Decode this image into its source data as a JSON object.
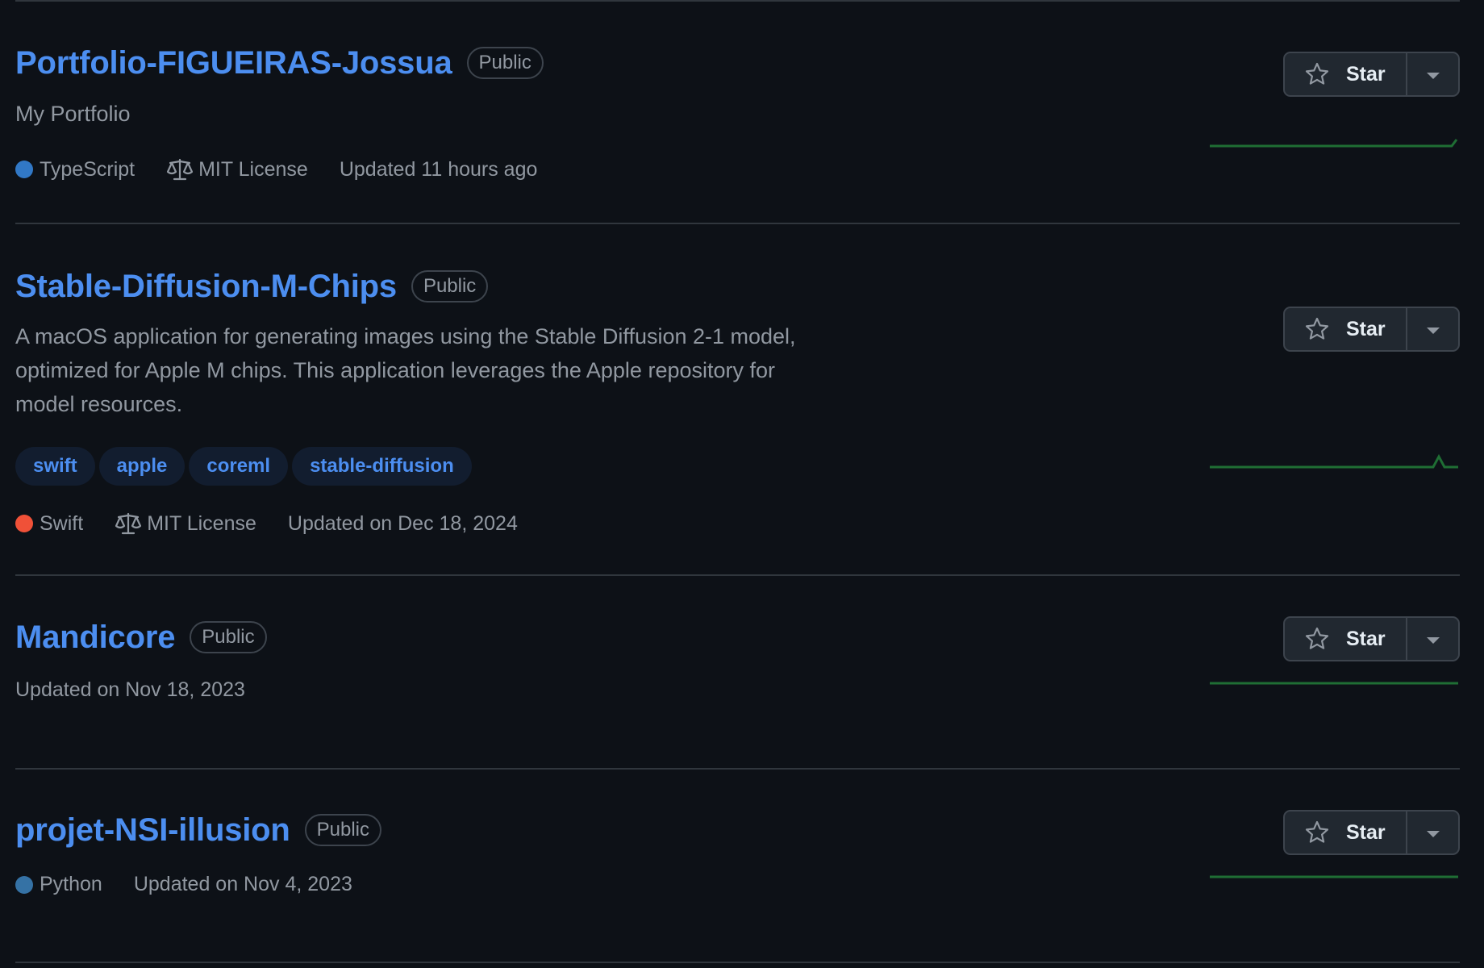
{
  "repos": [
    {
      "name": "Portfolio-FIGUEIRAS-Jossua",
      "visibility": "Public",
      "description": "My Portfolio",
      "topics": [],
      "language": "TypeScript",
      "language_color": "#3178c6",
      "license": "MIT License",
      "updated": "Updated 11 hours ago",
      "star_label": "Star"
    },
    {
      "name": "Stable-Diffusion-M-Chips",
      "visibility": "Public",
      "description": "A macOS application for generating images using the Stable Diffusion 2-1 model, optimized for Apple M chips. This application leverages the Apple repository for model resources.",
      "topics": [
        "swift",
        "apple",
        "coreml",
        "stable-diffusion"
      ],
      "language": "Swift",
      "language_color": "#f05138",
      "license": "MIT License",
      "updated": "Updated on Dec 18, 2024",
      "star_label": "Star"
    },
    {
      "name": "Mandicore",
      "visibility": "Public",
      "description": "",
      "topics": [],
      "language": "",
      "license": "",
      "updated": "Updated on Nov 18, 2023",
      "star_label": "Star"
    },
    {
      "name": "projet-NSI-illusion",
      "visibility": "Public",
      "description": "",
      "topics": [],
      "language": "Python",
      "language_color": "#3572a5",
      "license": "",
      "updated": "Updated on Nov 4, 2023",
      "star_label": "Star"
    }
  ],
  "icons": {
    "star": "star-icon",
    "dropdown": "triangle-down-icon",
    "license": "law-icon"
  },
  "colors": {
    "background": "#0d1117",
    "link": "#4c8ef0",
    "activity_line": "#1f6e34"
  }
}
